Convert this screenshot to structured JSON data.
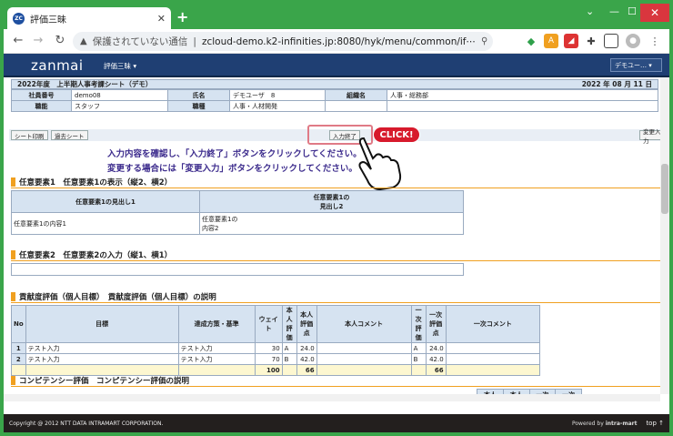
{
  "browser": {
    "tab_title": "評価三昧",
    "favicon": "ZC",
    "security_label": "保護されていない通信",
    "url": "zcloud-demo.k2-infinities.jp:8080/hyk/menu/common/if⋯"
  },
  "app": {
    "logo": "zanmai",
    "menu_label": "評価三昧 ▾",
    "user_menu": "デモユー… ▾"
  },
  "sheet": {
    "title": "2022年度　上半期人事考課シート（デモ）",
    "date": "2022 年 08 月 11 日",
    "labels": {
      "emp_no": "社員番号",
      "name": "氏名",
      "org": "組織名",
      "grade": "職能",
      "job": "職種"
    },
    "values": {
      "emp_no": "demo08",
      "name": "デモユーザ　8",
      "org": "人事・総務部",
      "grade": "スタッフ",
      "job": "人事・人材開発"
    }
  },
  "actions": {
    "print": "シート印刷",
    "past": "過去シート",
    "finish": "入力終了",
    "change": "変更入力"
  },
  "messages": {
    "line1": "入力内容を確認し、「入力終了」ボタンをクリックしてください。",
    "line2": "変更する場合には「変更入力」ボタンをクリックしてください。",
    "click_badge": "CLICK!"
  },
  "section1": {
    "heading": "任意要素1　任意要素1の表示（縦2、横2）",
    "h1": "任意要素1の見出し1",
    "h2a": "任意要素1の",
    "h2b": "見出し2",
    "c1": "任意要素1の内容1",
    "c2a": "任意要素1の",
    "c2b": "内容2"
  },
  "section2": {
    "heading": "任意要素2　任意要素2の入力（縦1、横1）"
  },
  "section3": {
    "heading": "貢献度評価（個人目標）　貢献度評価（個人目標）の説明",
    "headers": {
      "no": "No",
      "goal": "目標",
      "policy": "達成方策・基準",
      "weight": "ウェイト",
      "self_a": "本人",
      "self_b": "評価",
      "selfpt_a": "本人",
      "selfpt_b": "評価点",
      "self_comment": "本人コメント",
      "first_a": "一次",
      "first_b": "評価",
      "firstpt_a": "一次",
      "firstpt_b": "評価点",
      "first_comment": "一次コメント"
    },
    "rows": [
      {
        "no": "1",
        "goal": "テスト入力",
        "policy": "テスト入力",
        "weight": "30",
        "self": "A",
        "selfpt": "24.0",
        "first": "A",
        "firstpt": "24.0"
      },
      {
        "no": "2",
        "goal": "テスト入力",
        "policy": "テスト入力",
        "weight": "70",
        "self": "B",
        "selfpt": "42.0",
        "first": "B",
        "firstpt": "42.0"
      }
    ],
    "totals": {
      "weight": "100",
      "selfpt": "66",
      "firstpt": "66"
    }
  },
  "section4": {
    "heading": "コンピテンシー評価　コンピテンシー評価の説明",
    "partial_headers": {
      "a": "本人",
      "b": "本人",
      "c": "一次",
      "d": "一次"
    }
  },
  "footer": {
    "copyright": "Copyright @ 2012 NTT DATA INTRAMART CORPORATION.",
    "powered": "Powered by",
    "brand": "intra-mart",
    "top": "top ↑"
  },
  "colors": {
    "appbar": "#1f3f73",
    "frame": "#3aa54a",
    "accent": "#f0a020",
    "message": "#3b2a8c"
  }
}
